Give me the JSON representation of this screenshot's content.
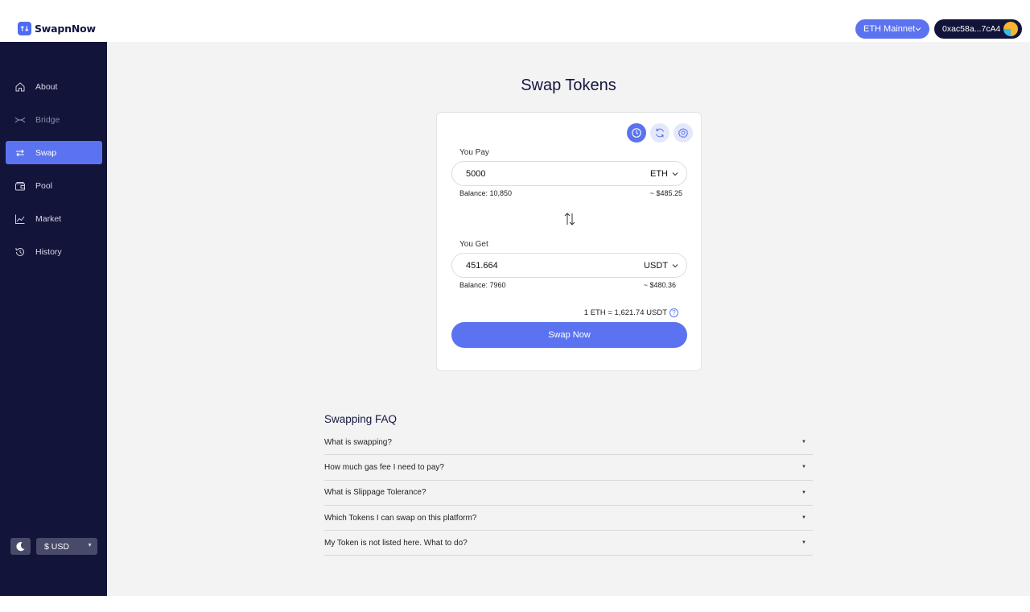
{
  "brand": {
    "name": "SwapnNow"
  },
  "header": {
    "network_label": "ETH Mainnet",
    "wallet_address": "0xac58a...7cA4"
  },
  "sidebar": {
    "items": [
      {
        "label": "About",
        "icon": "home-icon"
      },
      {
        "label": "Bridge",
        "icon": "bridge-icon"
      },
      {
        "label": "Swap",
        "icon": "swap-icon",
        "active": true
      },
      {
        "label": "Pool",
        "icon": "wallet-icon"
      },
      {
        "label": "Market",
        "icon": "chart-icon"
      },
      {
        "label": "History",
        "icon": "history-icon"
      }
    ],
    "currency": "$ USD",
    "theme_icon": "moon-icon"
  },
  "main": {
    "title": "Swap Tokens",
    "swap": {
      "pay_label": "You Pay",
      "pay_amount": "5000",
      "pay_token": "ETH",
      "pay_balance": "Balance: 10,850",
      "pay_usd": "~ $485.25",
      "get_label": "You Get",
      "get_amount": "451.664",
      "get_token": "USDT",
      "get_balance": "Balance: 7960",
      "get_usd": "~ $480.36",
      "rate": "1 ETH = 1,621.74 USDT",
      "button": "Swap Now",
      "tools": [
        "clock-icon",
        "refresh-icon",
        "settings-icon"
      ]
    },
    "faq": {
      "title": "Swapping FAQ",
      "items": [
        "What is swapping?",
        "How much gas fee I need to pay?",
        "What is Slippage Tolerance?",
        "Which Tokens I can swap on this platform?",
        "My Token is not listed here. What to do?"
      ]
    }
  },
  "colors": {
    "accent": "#5b73f0",
    "sidebar_bg": "#12143a",
    "main_bg": "#f3f3f4"
  }
}
